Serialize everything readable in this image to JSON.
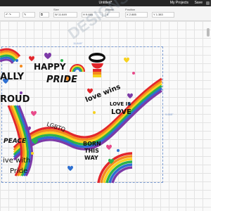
{
  "app": {
    "title": "Untitled*",
    "my_projects": "My Projects",
    "save": "Save"
  },
  "toolbar": {
    "size_label": "Size",
    "w_label": "W",
    "w_value": "11.649",
    "h_label": "H",
    "h_value": "9.665",
    "rotate_label": "Rotate",
    "rotate_value": "0",
    "position_label": "Position",
    "x_label": "X",
    "x_value": "2.885",
    "y_label": "Y",
    "y_value": "1.383"
  },
  "canvas": {
    "width_dim": "11.649\"",
    "height_dim": "9.665\""
  },
  "design": {
    "ally": "ALLY",
    "proud": "ROUD",
    "happy": "HAPPY",
    "pride": "PRIDE",
    "love_wins": "love wins",
    "lgbtq": "LGBTQ",
    "peace": "PEACE",
    "love_is_love_line1": "LOVE IS",
    "love_is_love_line2": "LOVE",
    "born_line1": "BORN",
    "born_line2": "THIS",
    "born_line3": "WAY",
    "live_line1": "ive with",
    "live_line2": "Pride",
    "watermark": "DESIGNS"
  },
  "colors": {
    "rainbow": [
      "#e2262c",
      "#f48a1f",
      "#f7d21f",
      "#2bb24c",
      "#2d6fd1",
      "#7d3aa8"
    ],
    "heart_pink": "#e84a8a",
    "heart_blue": "#2d6fd1",
    "heart_green": "#2bb24c",
    "heart_orange": "#f48a1f",
    "heart_purple": "#7d3aa8"
  }
}
